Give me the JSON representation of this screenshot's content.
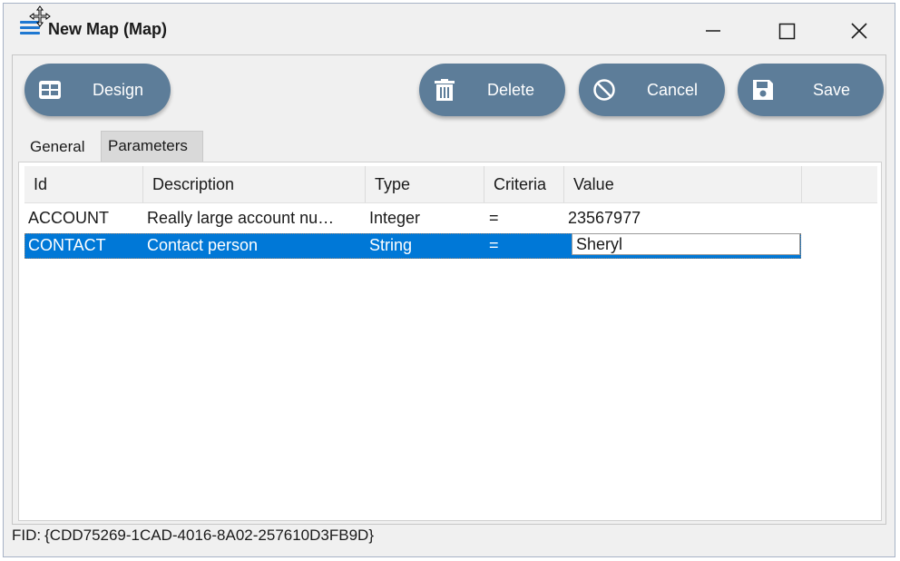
{
  "window": {
    "title": "New Map (Map)",
    "controls": {
      "minimize": "minimize-icon",
      "maximize": "maximize-icon",
      "close": "close-icon"
    }
  },
  "toolbar": {
    "design_label": "Design",
    "delete_label": "Delete",
    "cancel_label": "Cancel",
    "save_label": "Save"
  },
  "tabs": [
    {
      "label": "General",
      "selected": false
    },
    {
      "label": "Parameters",
      "selected": true
    }
  ],
  "grid": {
    "columns": [
      "Id",
      "Description",
      "Type",
      "Criteria",
      "Value"
    ],
    "rows": [
      {
        "id": "ACCOUNT",
        "description": "Really large account nu…",
        "type": "Integer",
        "criteria": "=",
        "value": "23567977",
        "selected": false
      },
      {
        "id": "CONTACT",
        "description": "Contact person",
        "type": "String",
        "criteria": "=",
        "value": "Sheryl",
        "selected": true
      }
    ]
  },
  "footer": {
    "fid_label": "FID:",
    "fid_value": "{CDD75269-1CAD-4016-8A02-257610D3FB9D}"
  },
  "colors": {
    "button_bg": "#5d7d99",
    "selection": "#0078d7",
    "app_icon": "#1f78d1"
  }
}
